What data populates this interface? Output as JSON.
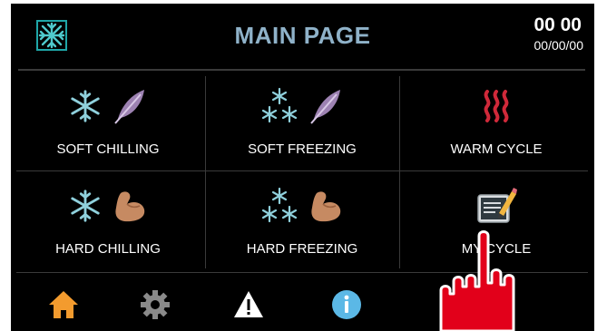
{
  "header": {
    "title": "MAIN PAGE",
    "time": "00 00",
    "date": "00/00/00",
    "logo_icon": "snowflake-logo-icon"
  },
  "cycles": [
    {
      "label": "SOFT CHILLING",
      "icons": [
        "snowflake-icon",
        "feather-icon"
      ]
    },
    {
      "label": "SOFT FREEZING",
      "icons": [
        "triple-snowflake-icon",
        "feather-icon"
      ]
    },
    {
      "label": "WARM CYCLE",
      "icons": [
        "heat-waves-icon"
      ]
    },
    {
      "label": "HARD CHILLING",
      "icons": [
        "snowflake-icon",
        "flexed-bicep-icon"
      ]
    },
    {
      "label": "HARD FREEZING",
      "icons": [
        "triple-snowflake-icon",
        "flexed-bicep-icon"
      ]
    },
    {
      "label": "MY CYCLE",
      "icons": [
        "memo-pencil-icon"
      ]
    }
  ],
  "footer": {
    "icons": [
      "home-icon",
      "settings-gear-icon",
      "warning-icon",
      "info-icon"
    ]
  },
  "colors": {
    "title": "#8fb2c9",
    "snowflake": "#8fd0dc",
    "feather": "#9d82b2",
    "heat": "#d0293a",
    "home": "#f39b2e",
    "gear": "#8a8a8a",
    "info": "#5bb8e6",
    "hand": "#e2001a"
  }
}
